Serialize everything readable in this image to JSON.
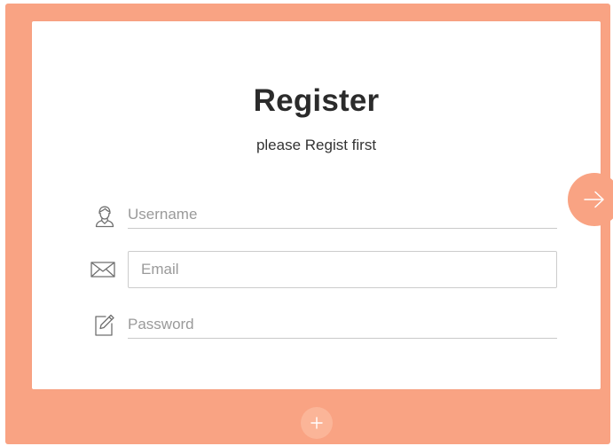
{
  "colors": {
    "accent": "#f9a383",
    "card": "#ffffff",
    "title_text": "#2b2b2b",
    "placeholder": "#9a9a9a"
  },
  "form": {
    "title": "Register",
    "subtitle": "please Regist first",
    "username": {
      "placeholder": "Username",
      "value": "",
      "icon": "user-icon"
    },
    "email": {
      "placeholder": "Email",
      "value": "",
      "icon": "envelope-icon"
    },
    "password": {
      "placeholder": "Password",
      "value": "",
      "icon": "edit-icon"
    }
  },
  "actions": {
    "next_icon": "arrow-right-icon",
    "add_icon": "plus-icon"
  }
}
